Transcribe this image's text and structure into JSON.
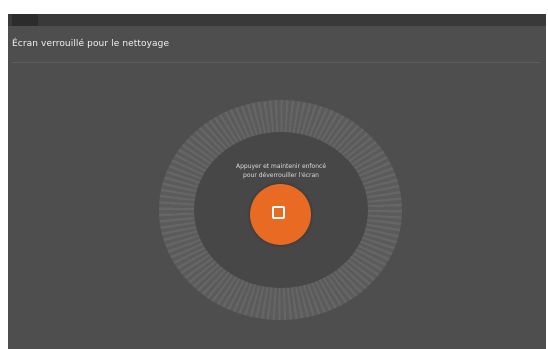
{
  "screen": {
    "title": "Écran verrouillé pour le nettoyage"
  },
  "lock_control": {
    "instruction_line1": "Appuyer et maintenir enfoncé",
    "instruction_line2": "pour déverrouiller l'écran",
    "button_icon": "square-icon"
  },
  "colors": {
    "background": "#4e4e4e",
    "ring": "#666666",
    "inner_disc": "#474747",
    "accent": "#e96a22"
  }
}
